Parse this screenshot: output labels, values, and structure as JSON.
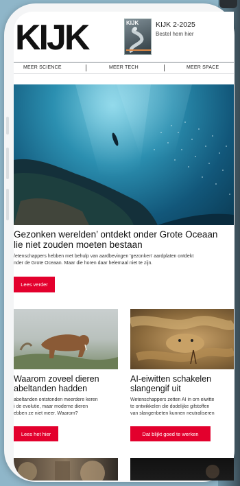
{
  "header": {
    "logo_text": "KIJK",
    "issue_title": "KIJK 2-2025",
    "issue_subtitle": "Bestel hem hier",
    "cover_label": "KIJK"
  },
  "nav": {
    "items": [
      "MEER SCIENCE",
      "MEER TECH",
      "MEER SPACE"
    ]
  },
  "hero": {
    "title_lines": [
      "Gezonken werelden’ ontdekt onder Grote Oceaan",
      "lie niet zouden moeten bestaan"
    ],
    "desc_lines": [
      "/etenschappers hebben met behulp van aardbevingen 'gezonken' aardplaten ontdekt",
      "nder de Grote Oceaan. Maar die horen daar helemaal niet te zijn."
    ],
    "button": "Lees verder"
  },
  "cards": [
    {
      "title_lines": [
        "Waarom zoveel dieren",
        "abeltanden hadden"
      ],
      "desc_lines": [
        "abeltanden ontstonden meerdere keren",
        "i de evolutie, maar moderne dieren",
        "ebben ze niet meer. Waarom?"
      ],
      "button": "Lees het hier"
    },
    {
      "title_lines": [
        "AI-eiwitten schakelen",
        "slangengif uit"
      ],
      "desc_lines": [
        "Wetenschappers zetten AI in om eiwitte",
        "te ontwikkelen die dodelijke gifstoffen",
        "van slangenbeten kunnen neutraliseren"
      ],
      "button": "Dat blijkt goed te werken"
    }
  ],
  "colors": {
    "accent": "#e3002d",
    "background": "#8fb6c9"
  }
}
